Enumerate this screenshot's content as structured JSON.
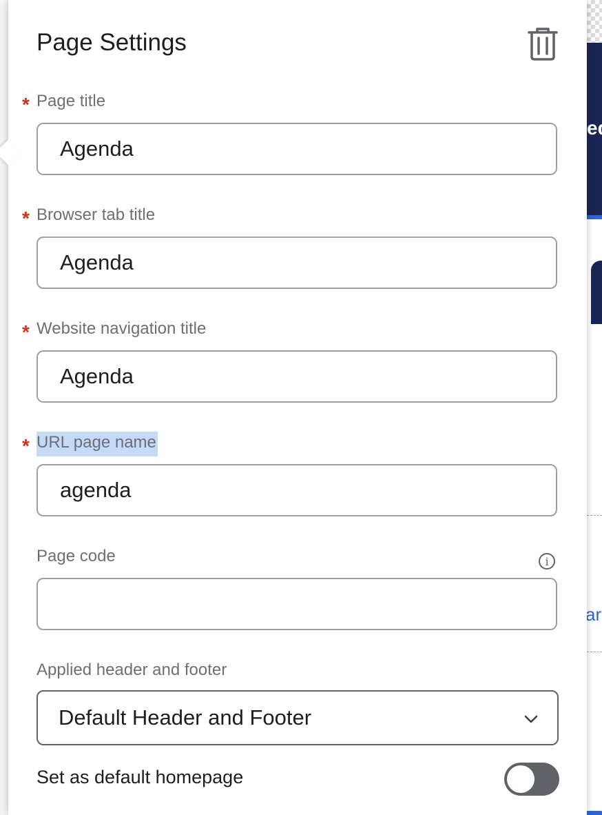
{
  "panel": {
    "title": "Page Settings",
    "delete_icon": "trash-icon"
  },
  "fields": {
    "page_title": {
      "label": "Page title",
      "value": "Agenda",
      "required": true
    },
    "browser_tab_title": {
      "label": "Browser tab title",
      "value": "Agenda",
      "required": true
    },
    "nav_title": {
      "label": "Website navigation title",
      "value": "Agenda",
      "required": true
    },
    "url_page_name": {
      "label": "URL page name",
      "value": "agenda",
      "required": true
    },
    "page_code": {
      "label": "Page code",
      "value": "",
      "required": false,
      "info_icon": "info-icon"
    },
    "header_footer": {
      "label": "Applied header and footer",
      "selected": "Default Header and Footer"
    },
    "default_homepage": {
      "label": "Set as default homepage",
      "enabled": false
    }
  },
  "required_marker": "*",
  "background": {
    "partial_text_1": "ed",
    "partial_text_2": "ar"
  },
  "colors": {
    "required": "#d3301c",
    "label": "#6b6f76",
    "text": "#1c1e21",
    "border": "#9aa0a6",
    "selection": "#c5daf7",
    "toggle_off": "#5f6368"
  }
}
